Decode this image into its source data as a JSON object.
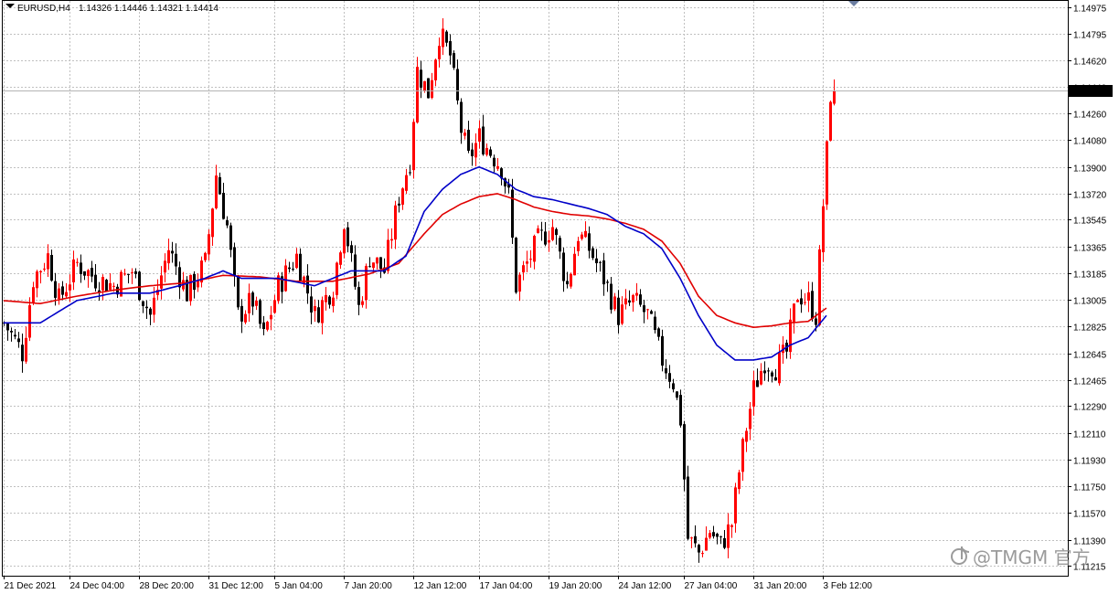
{
  "header": {
    "symbol_timeframe": "EURUSD,H4",
    "ohlc": "1.14326 1.14446 1.14321 1.14414"
  },
  "watermark": {
    "text": "@TMGM 官方",
    "icon": "tiktok-icon"
  },
  "colors": {
    "background": "#ffffff",
    "grid": "#c0c0c0",
    "bull_candle": "#ff0000",
    "bear_candle": "#000000",
    "ma_fast": "#0000c8",
    "ma_slow": "#e00000",
    "price_tag_bg": "#000000",
    "price_tag_fg": "#ffffff"
  },
  "chart_data": {
    "type": "candlestick",
    "symbol": "EURUSD",
    "timeframe": "H4",
    "last_price": "1.14414",
    "ylim": [
      1.1211,
      1.1502
    ],
    "grid": true,
    "price_ticks": [
      "1.14975",
      "1.14795",
      "1.14620",
      "1.14440",
      "1.14260",
      "1.14080",
      "1.13900",
      "1.13720",
      "1.13545",
      "1.13365",
      "1.13185",
      "1.13005",
      "1.12825",
      "1.12645",
      "1.12465",
      "1.12290",
      "1.12110",
      "1.11930",
      "1.11750",
      "1.11570",
      "1.11390",
      "1.11215"
    ],
    "time_ticks": [
      {
        "index": 0,
        "label": "21 Dec 2021"
      },
      {
        "index": 18,
        "label": "24 Dec 04:00"
      },
      {
        "index": 37,
        "label": "28 Dec 20:00"
      },
      {
        "index": 56,
        "label": "31 Dec 12:00"
      },
      {
        "index": 74,
        "label": "5 Jan 04:00"
      },
      {
        "index": 93,
        "label": "7 Jan 20:00"
      },
      {
        "index": 112,
        "label": "12 Jan 12:00"
      },
      {
        "index": 130,
        "label": "17 Jan 04:00"
      },
      {
        "index": 149,
        "label": "19 Jan 20:00"
      },
      {
        "index": 168,
        "label": "24 Jan 12:00"
      },
      {
        "index": 186,
        "label": "27 Jan 04:00"
      },
      {
        "index": 205,
        "label": "31 Jan 20:00"
      },
      {
        "index": 224,
        "label": "3 Feb 12:00"
      }
    ],
    "close_path": [
      [
        0,
        1.1285
      ],
      [
        5,
        1.1265
      ],
      [
        8,
        1.1315
      ],
      [
        12,
        1.133
      ],
      [
        15,
        1.13
      ],
      [
        20,
        1.1325
      ],
      [
        25,
        1.1315
      ],
      [
        30,
        1.131
      ],
      [
        35,
        1.132
      ],
      [
        40,
        1.129
      ],
      [
        45,
        1.1335
      ],
      [
        50,
        1.1305
      ],
      [
        55,
        1.1325
      ],
      [
        58,
        1.1385
      ],
      [
        61,
        1.135
      ],
      [
        64,
        1.129
      ],
      [
        68,
        1.13
      ],
      [
        71,
        1.1275
      ],
      [
        75,
        1.131
      ],
      [
        80,
        1.133
      ],
      [
        85,
        1.129
      ],
      [
        90,
        1.131
      ],
      [
        93,
        1.1355
      ],
      [
        97,
        1.1295
      ],
      [
        100,
        1.133
      ],
      [
        104,
        1.132
      ],
      [
        108,
        1.137
      ],
      [
        111,
        1.1395
      ],
      [
        113,
        1.1455
      ],
      [
        116,
        1.144
      ],
      [
        119,
        1.148
      ],
      [
        122,
        1.1465
      ],
      [
        125,
        1.1415
      ],
      [
        127,
        1.1395
      ],
      [
        130,
        1.141
      ],
      [
        133,
        1.14
      ],
      [
        136,
        1.139
      ],
      [
        138,
        1.137
      ],
      [
        140,
        1.131
      ],
      [
        143,
        1.1325
      ],
      [
        146,
        1.134
      ],
      [
        150,
        1.135
      ],
      [
        154,
        1.131
      ],
      [
        157,
        1.1345
      ],
      [
        160,
        1.1335
      ],
      [
        164,
        1.1315
      ],
      [
        168,
        1.129
      ],
      [
        172,
        1.13
      ],
      [
        176,
        1.129
      ],
      [
        180,
        1.126
      ],
      [
        183,
        1.1245
      ],
      [
        185,
        1.122
      ],
      [
        187,
        1.114
      ],
      [
        190,
        1.113
      ],
      [
        193,
        1.1145
      ],
      [
        196,
        1.1135
      ],
      [
        199,
        1.115
      ],
      [
        201,
        1.1185
      ],
      [
        203,
        1.1215
      ],
      [
        205,
        1.124
      ],
      [
        208,
        1.126
      ],
      [
        211,
        1.1255
      ],
      [
        214,
        1.1265
      ],
      [
        217,
        1.1305
      ],
      [
        220,
        1.13
      ],
      [
        222,
        1.129
      ],
      [
        224,
        1.1365
      ],
      [
        225,
        1.14
      ],
      [
        226,
        1.144
      ],
      [
        227,
        1.1441
      ]
    ],
    "ma_fast_path": [
      [
        0,
        1.1285
      ],
      [
        10,
        1.1285
      ],
      [
        20,
        1.13
      ],
      [
        30,
        1.1305
      ],
      [
        40,
        1.1305
      ],
      [
        48,
        1.131
      ],
      [
        55,
        1.1315
      ],
      [
        60,
        1.132
      ],
      [
        65,
        1.1315
      ],
      [
        75,
        1.1315
      ],
      [
        85,
        1.131
      ],
      [
        95,
        1.132
      ],
      [
        104,
        1.132
      ],
      [
        110,
        1.133
      ],
      [
        115,
        1.136
      ],
      [
        120,
        1.1375
      ],
      [
        125,
        1.1385
      ],
      [
        130,
        1.139
      ],
      [
        135,
        1.1385
      ],
      [
        140,
        1.1375
      ],
      [
        145,
        1.137
      ],
      [
        150,
        1.1368
      ],
      [
        155,
        1.1365
      ],
      [
        160,
        1.1362
      ],
      [
        165,
        1.1358
      ],
      [
        170,
        1.135
      ],
      [
        175,
        1.1345
      ],
      [
        180,
        1.1335
      ],
      [
        185,
        1.1315
      ],
      [
        190,
        1.129
      ],
      [
        195,
        1.127
      ],
      [
        200,
        1.126
      ],
      [
        205,
        1.126
      ],
      [
        210,
        1.1262
      ],
      [
        215,
        1.127
      ],
      [
        220,
        1.1275
      ],
      [
        225,
        1.129
      ]
    ],
    "ma_slow_path": [
      [
        0,
        1.13
      ],
      [
        10,
        1.1298
      ],
      [
        20,
        1.1303
      ],
      [
        30,
        1.1307
      ],
      [
        40,
        1.131
      ],
      [
        50,
        1.1312
      ],
      [
        60,
        1.1317
      ],
      [
        70,
        1.1316
      ],
      [
        80,
        1.1313
      ],
      [
        90,
        1.1313
      ],
      [
        100,
        1.1318
      ],
      [
        108,
        1.1325
      ],
      [
        115,
        1.1345
      ],
      [
        120,
        1.1358
      ],
      [
        125,
        1.1365
      ],
      [
        130,
        1.137
      ],
      [
        135,
        1.1372
      ],
      [
        140,
        1.1368
      ],
      [
        145,
        1.1363
      ],
      [
        150,
        1.136
      ],
      [
        155,
        1.1358
      ],
      [
        160,
        1.1357
      ],
      [
        165,
        1.1355
      ],
      [
        170,
        1.1352
      ],
      [
        175,
        1.1348
      ],
      [
        180,
        1.134
      ],
      [
        185,
        1.1325
      ],
      [
        190,
        1.1303
      ],
      [
        195,
        1.129
      ],
      [
        200,
        1.1285
      ],
      [
        205,
        1.1282
      ],
      [
        210,
        1.1283
      ],
      [
        215,
        1.1285
      ],
      [
        220,
        1.1286
      ],
      [
        225,
        1.1295
      ]
    ]
  }
}
